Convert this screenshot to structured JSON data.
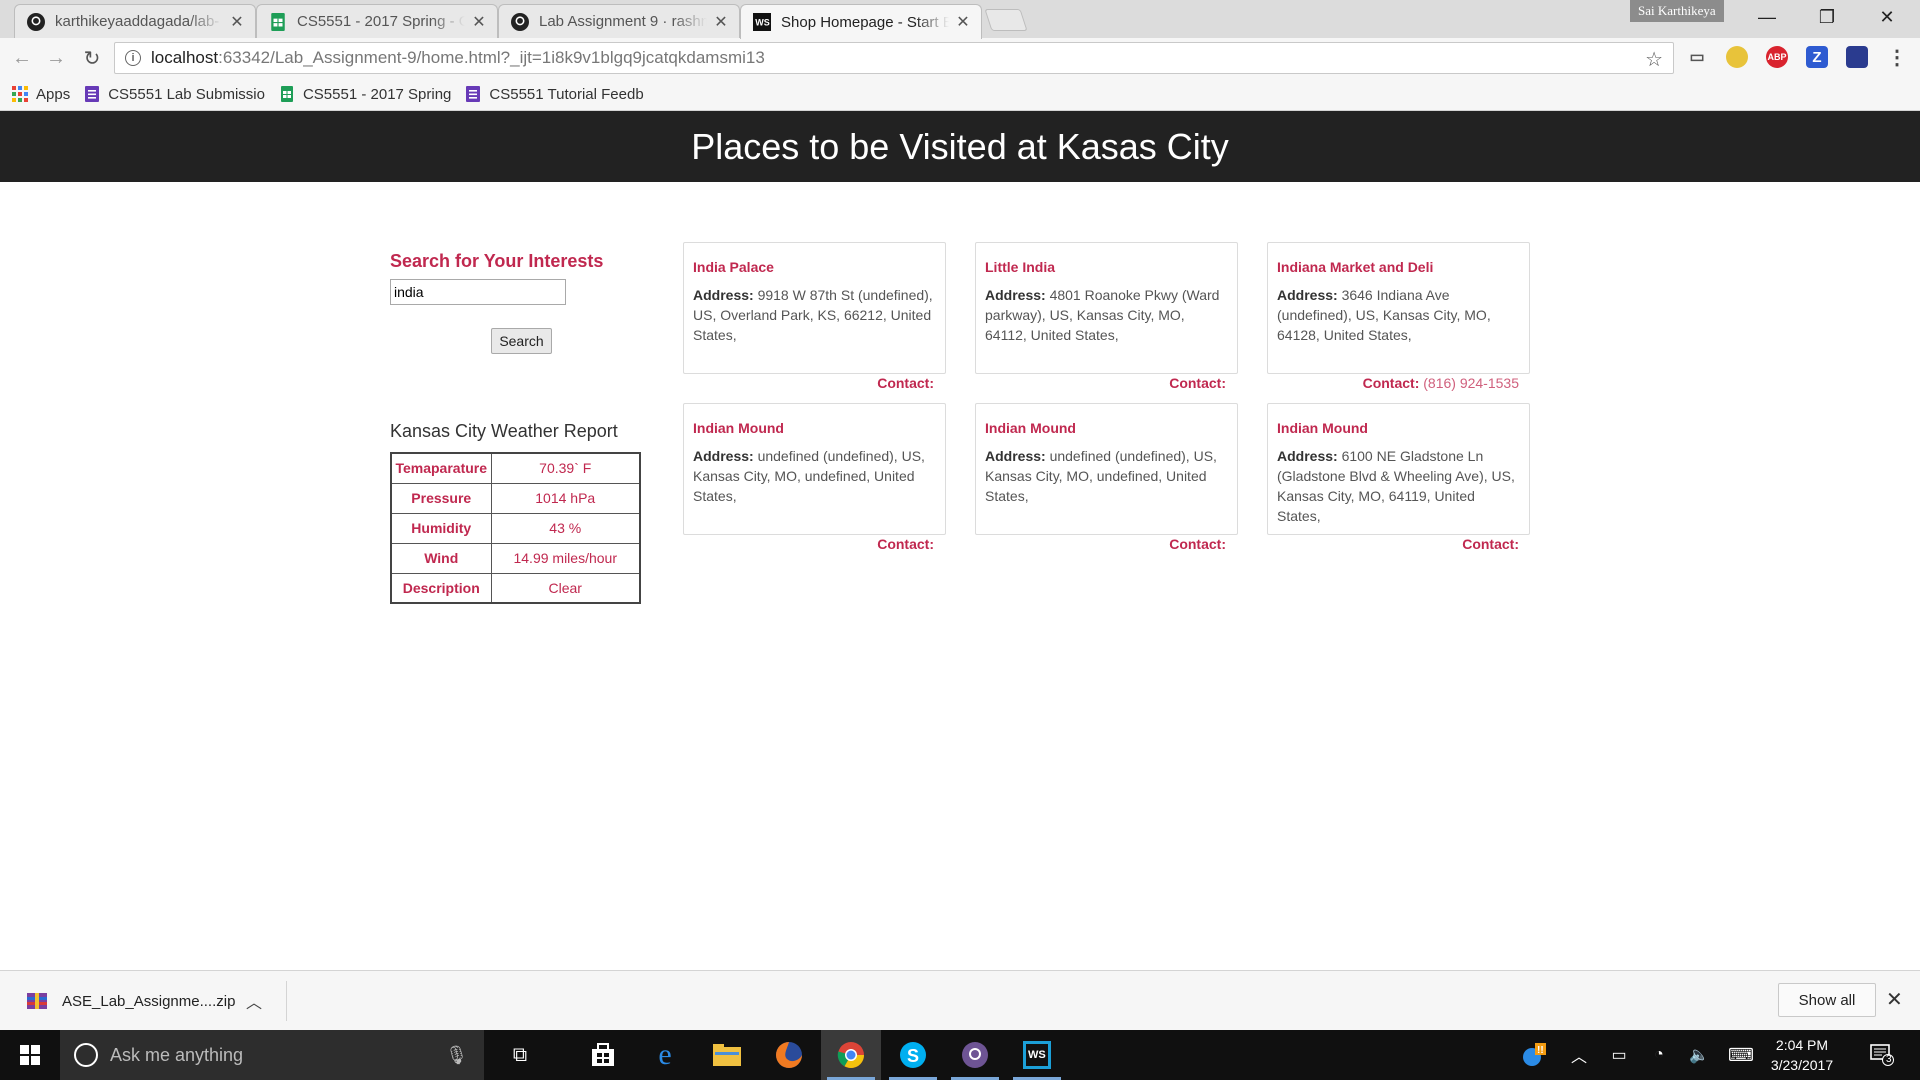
{
  "browser": {
    "tabs": [
      {
        "title": "karthikeyaaddagada/lab-",
        "icon": "github-icon"
      },
      {
        "title": "CS5551 - 2017 Spring - G",
        "icon": "sheets-icon"
      },
      {
        "title": "Lab Assignment 9 · rashm",
        "icon": "github-icon"
      },
      {
        "title": "Shop Homepage - Start B",
        "icon": "webstorm-icon"
      }
    ],
    "profile": "Sai Karthikeya",
    "url_host": "localhost",
    "url_path": ":63342/Lab_Assignment-9/home.html?_ijt=1i8k9v1blgq9jcatqkdamsmi13",
    "bookmarks": [
      {
        "label": "Apps",
        "icon": "apps-grid-icon"
      },
      {
        "label": "CS5551 Lab Submissio",
        "icon": "form-icon"
      },
      {
        "label": "CS5551 - 2017 Spring",
        "icon": "sheets-icon"
      },
      {
        "label": "CS5551 Tutorial Feedb",
        "icon": "form-icon"
      }
    ],
    "extensions": {
      "abp": "ABP",
      "z": "Z"
    }
  },
  "page": {
    "banner_title": "Places to be Visited at Kasas City",
    "search": {
      "heading": "Search for Your Interests",
      "value": "india",
      "button": "Search"
    },
    "weather": {
      "title": "Kansas City Weather Report",
      "rows": [
        {
          "label": "Temaparature",
          "value": "70.39` F"
        },
        {
          "label": "Pressure",
          "value": "1014 hPa"
        },
        {
          "label": "Humidity",
          "value": "43 %"
        },
        {
          "label": "Wind",
          "value": "14.99 miles/hour"
        },
        {
          "label": "Description",
          "value": "Clear"
        }
      ]
    },
    "address_label": "Address:",
    "contact_label": "Contact:",
    "places": [
      {
        "name": "India Palace",
        "address": "9918 W 87th St (undefined), US, Overland Park, KS, 66212, United States,",
        "contact": ""
      },
      {
        "name": "Little India",
        "address": "4801 Roanoke Pkwy (Ward parkway), US, Kansas City, MO, 64112, United States,",
        "contact": ""
      },
      {
        "name": "Indiana Market and Deli",
        "address": "3646 Indiana Ave (undefined), US, Kansas City, MO, 64128, United States,",
        "contact": "(816) 924-1535"
      },
      {
        "name": "Indian Mound",
        "address": "undefined (undefined), US, Kansas City, MO, undefined, United States,",
        "contact": ""
      },
      {
        "name": "Indian Mound",
        "address": "undefined (undefined), US, Kansas City, MO, undefined, United States,",
        "contact": ""
      },
      {
        "name": "Indian Mound",
        "address": "6100 NE Gladstone Ln (Gladstone Blvd & Wheeling Ave), US, Kansas City, MO, 64119, United States,",
        "contact": ""
      }
    ]
  },
  "downloads": {
    "file": "ASE_Lab_Assignme....zip",
    "show_all": "Show all"
  },
  "taskbar": {
    "search_placeholder": "Ask me anything",
    "time": "2:04 PM",
    "date": "3/23/2017",
    "notification_count": "3"
  },
  "colors": {
    "accent": "#c0284f",
    "banner_bg": "#222222"
  }
}
